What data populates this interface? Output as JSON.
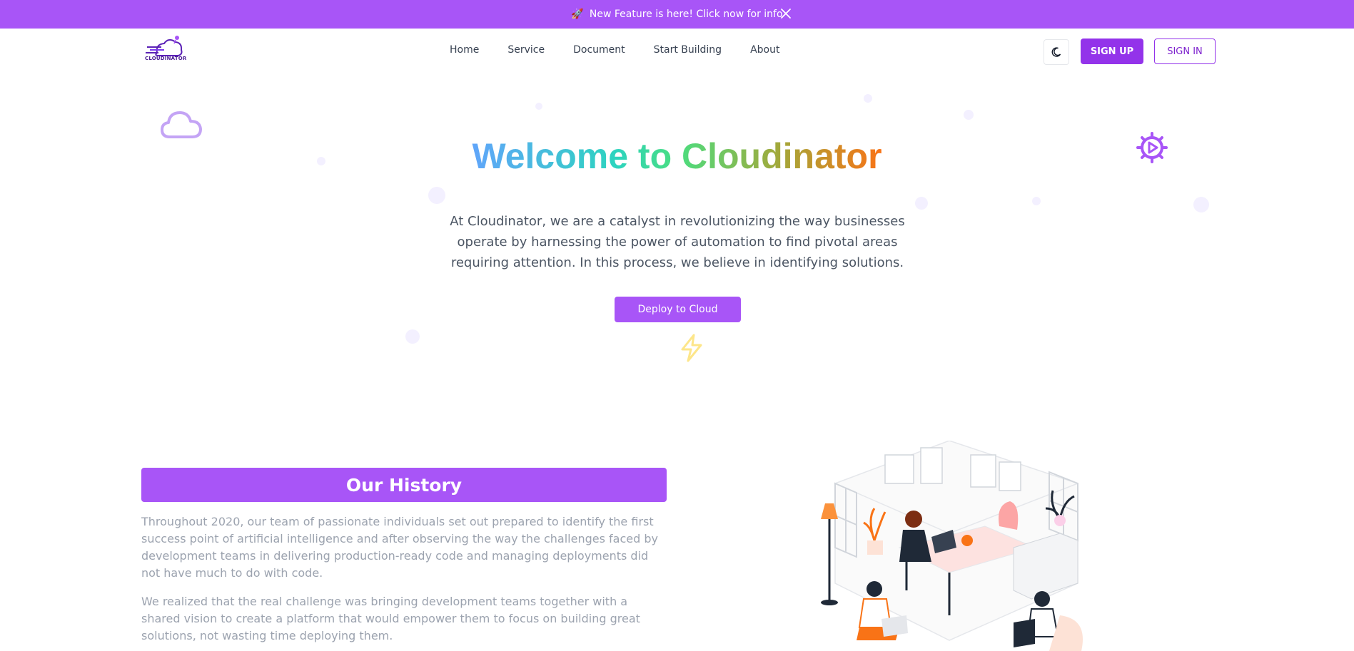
{
  "banner": {
    "text": "New Feature is here! Click now for info",
    "icon": "rocket-icon",
    "close_icon": "close-icon",
    "color": "#a855f7"
  },
  "logo": {
    "text": "CLOUDINATOR"
  },
  "nav": {
    "items": [
      {
        "label": "Home"
      },
      {
        "label": "Service"
      },
      {
        "label": "Document"
      },
      {
        "label": "Start Building"
      },
      {
        "label": "About"
      }
    ],
    "theme_icon": "moon-icon",
    "signup_label": "SIGN UP",
    "signin_label": "SIGN IN"
  },
  "hero": {
    "title": "Welcome to Cloudinator",
    "description": "At Cloudinator, we are a catalyst in revolutionizing the way businesses operate by harnessing the power of automation to find pivotal areas requiring attention. In this process, we believe in identifying solutions.",
    "cta_label": "Deploy to Cloud"
  },
  "history": {
    "title": "Our History",
    "paragraph1": "Throughout 2020, our team of passionate individuals set out prepared to identify the first success point of artificial intelligence and after observing the way the challenges faced by development teams in delivering production-ready code and managing deployments did not have much to do with code.",
    "paragraph2": "We realized that the real challenge was bringing development teams together with a shared vision to create a platform that would empower them to focus on building great solutions, not wasting time deploying them."
  },
  "colors": {
    "accent": "#a855f7",
    "accent_dark": "#9333ea"
  }
}
